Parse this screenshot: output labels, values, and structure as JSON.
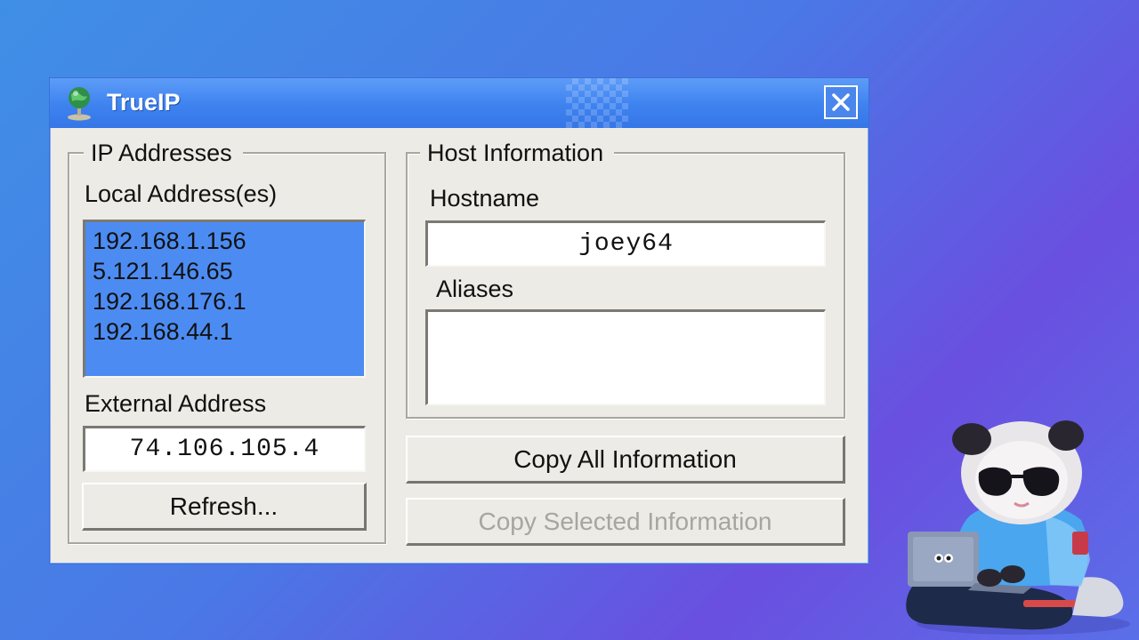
{
  "window": {
    "title": "TrueIP"
  },
  "ip_group": {
    "legend": "IP Addresses",
    "local_label": "Local Address(es)",
    "local_addresses": [
      "192.168.1.156",
      "5.121.146.65",
      "192.168.176.1",
      "192.168.44.1"
    ],
    "external_label": "External Address",
    "external_value": "74.106.105.4",
    "refresh_label": "Refresh..."
  },
  "host_group": {
    "legend": "Host Information",
    "hostname_label": "Hostname",
    "hostname_value": "joey64",
    "aliases_label": "Aliases",
    "aliases_value": ""
  },
  "buttons": {
    "copy_all": "Copy All Information",
    "copy_selected": "Copy Selected Information"
  },
  "icons": {
    "app": "globe-icon",
    "close": "close-icon",
    "mascot": "panda-mascot"
  }
}
